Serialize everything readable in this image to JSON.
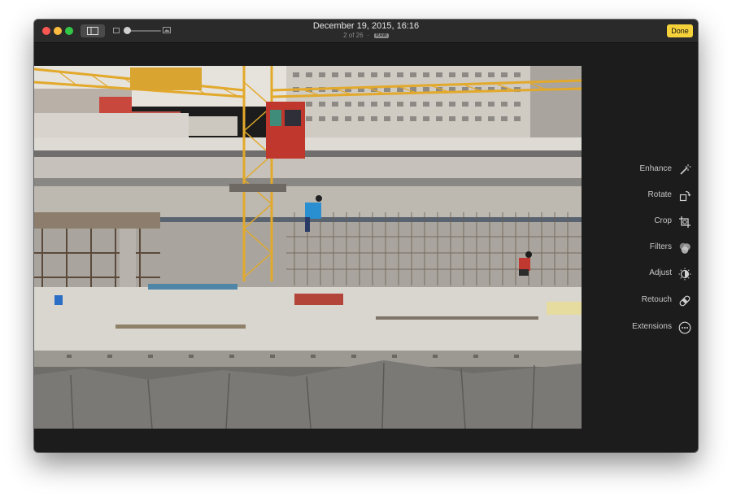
{
  "window": {
    "title_date": "December 19, 2015, 16:16",
    "photo_position": "2 of 26",
    "format_badge": "RAW",
    "done_label": "Done"
  },
  "zoom": {
    "level": 0.05
  },
  "tools": [
    {
      "label": "Enhance",
      "icon": "magic-wand-icon"
    },
    {
      "label": "Rotate",
      "icon": "rotate-icon"
    },
    {
      "label": "Crop",
      "icon": "crop-icon"
    },
    {
      "label": "Filters",
      "icon": "filters-icon"
    },
    {
      "label": "Adjust",
      "icon": "adjust-icon"
    },
    {
      "label": "Retouch",
      "icon": "bandage-icon"
    },
    {
      "label": "Extensions",
      "icon": "more-icon"
    }
  ],
  "colors": {
    "accent": "#f6d23a",
    "window_bg": "#1c1c1c",
    "titlebar_bg": "#2a2a2a"
  }
}
